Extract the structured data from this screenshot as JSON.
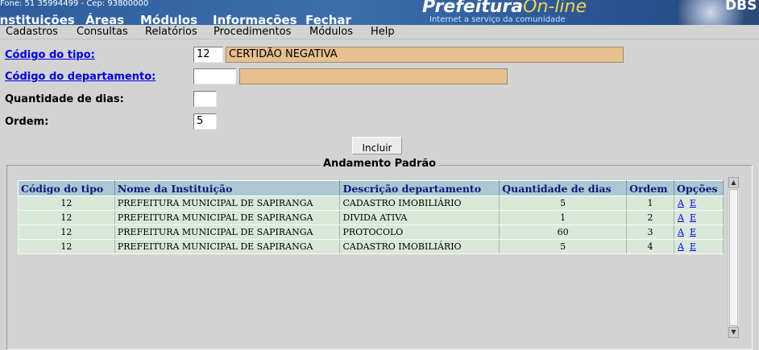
{
  "banner": {
    "phone": "Fone: 51 35994499  -  Cep: 93800000",
    "top_menu": [
      "Instituições",
      "Áreas",
      "Módulos",
      "Informações",
      "Fechar"
    ],
    "logo_main": "Prefeitura",
    "logo_accent": "On-line",
    "tagline": "Internet a serviço da comunidade",
    "corner_logo": "DBS"
  },
  "menubar": [
    "Cadastros",
    "Consultas",
    "Relatórios",
    "Procedimentos",
    "Módulos",
    "Help"
  ],
  "form": {
    "codigo_tipo_label": "Código do tipo:",
    "codigo_tipo_value": "12",
    "codigo_tipo_desc": "CERTIDÃO NEGATIVA",
    "codigo_depto_label": "Código do departamento:",
    "codigo_depto_value": "",
    "codigo_depto_desc": "",
    "qtd_dias_label": "Quantidade de dias:",
    "qtd_dias_value": "",
    "ordem_label": "Ordem:",
    "ordem_value": "5",
    "incluir_label": "Incluir"
  },
  "fieldset_legend": "Andamento Padrão",
  "table": {
    "headers": [
      "Código do tipo",
      "Nome da Instituição",
      "Descrição departamento",
      "Quantidade de dias",
      "Ordem",
      "Opções"
    ],
    "rows": [
      {
        "codigo": "12",
        "instituicao": "PREFEITURA MUNICIPAL DE SAPIRANGA",
        "departamento": "CADASTRO IMOBILIÁRIO",
        "dias": "5",
        "ordem": "1",
        "opt_a": "A",
        "opt_e": "E"
      },
      {
        "codigo": "12",
        "instituicao": "PREFEITURA MUNICIPAL DE SAPIRANGA",
        "departamento": "DIVIDA ATIVA",
        "dias": "1",
        "ordem": "2",
        "opt_a": "A",
        "opt_e": "E"
      },
      {
        "codigo": "12",
        "instituicao": "PREFEITURA MUNICIPAL DE SAPIRANGA",
        "departamento": "PROTOCOLO",
        "dias": "60",
        "ordem": "3",
        "opt_a": "A",
        "opt_e": "E"
      },
      {
        "codigo": "12",
        "instituicao": "PREFEITURA MUNICIPAL DE SAPIRANGA",
        "departamento": "CADASTRO IMOBILIÁRIO",
        "dias": "5",
        "ordem": "4",
        "opt_a": "A",
        "opt_e": "E"
      }
    ]
  },
  "colors": {
    "banner": "#2f5d9c",
    "logo_accent": "#f0d64a",
    "readonly_field": "#e6c08e",
    "table_header": "#acc7d3",
    "table_row": "#d9e8d9",
    "link": "#0000ee"
  }
}
